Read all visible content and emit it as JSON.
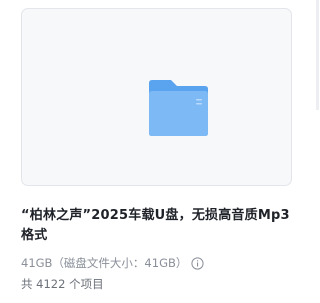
{
  "item": {
    "thumbnail_icon": "folder-icon",
    "title": "“柏林之声”2025车载U盘，无损高音质Mp3格式",
    "size_text": "41GB（磁盘文件大小：41GB）",
    "info_icon": "info-circle-icon",
    "count_text": "共 4122 个项目"
  },
  "colors": {
    "folder_back": "#5aa3ef",
    "folder_front": "#7bb9f5",
    "title_text": "#1f2329",
    "meta_text": "#8a8f99"
  }
}
